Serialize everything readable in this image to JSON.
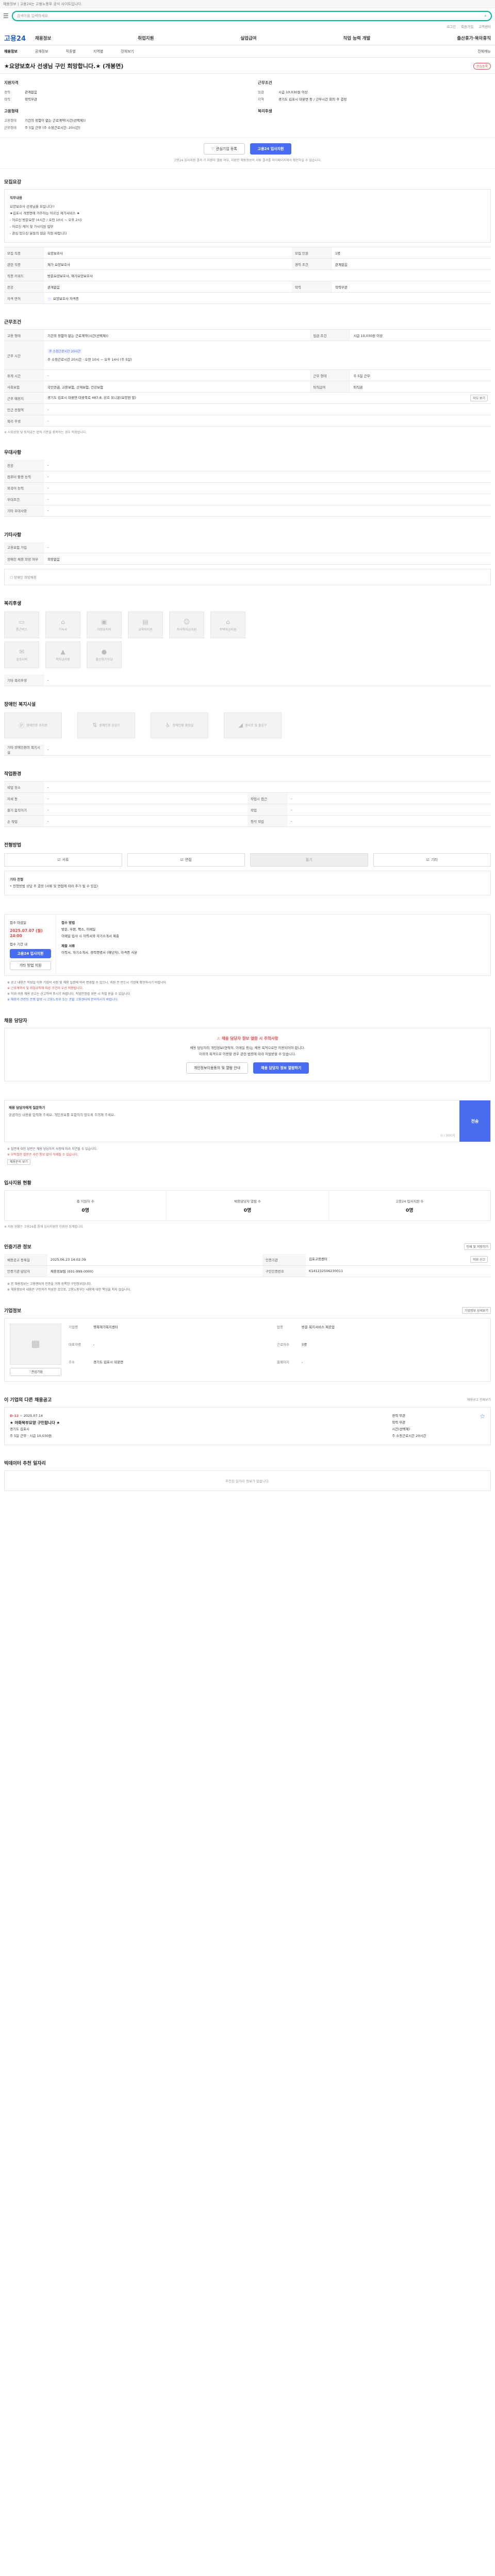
{
  "notice": "채용정보 | 고용24는 고용노동부 공식 사이트입니다.",
  "search": {
    "placeholder": "검색어를 입력하세요"
  },
  "util": [
    "로그인",
    "회원가입",
    "고객센터"
  ],
  "logo": "고용24",
  "gnb": [
    "채용정보",
    "취업지원",
    "실업급여",
    "직업 능력 개발",
    "출산휴가·육아휴직"
  ],
  "subnav": [
    "채용정보",
    "공채정보",
    "직종별",
    "지역별",
    "전체보기",
    "전체메뉴"
  ],
  "title": "★요양보호사 선생님 구인 희망합니다.★ (개봉면)",
  "scrap": "관심등록",
  "summary": {
    "left_title": "지원자격",
    "left": [
      [
        "경력",
        "관계없음"
      ],
      [
        "학력",
        "학력무관"
      ]
    ],
    "right_title": "근무조건",
    "right": [
      [
        "임금",
        "시급 10,030원 이상"
      ],
      [
        "지역",
        "경기도 김포시 대곶면 등 / 근무시간 회의 후 결정"
      ]
    ],
    "left2_title": "고용형태",
    "left2": [
      [
        "고용형태",
        "기간의 정함이 없는 근로계약(시간(선택제))"
      ],
      [
        "근무형태",
        "주 5일 근무 (주 소정근로시간: 20시간)"
      ]
    ],
    "right2_title": "복리후생",
    "right2": []
  },
  "apply": {
    "interest_btn": "관심기업 등록",
    "apply_btn": "고용24 입사지원",
    "note": "고용24 입사지원 결과 기 지원자 열람 여부, 지원한 채용정보의 서류 결과를 마이페이지에서 확인하실 수 있습니다."
  },
  "recruit": {
    "heading": "모집요강",
    "box_title": "직무내용",
    "box_lines": [
      "요양보호사 선생님을 모십니다!!",
      "★김포시 개봉면에 거주하는 어르신 재가서비스 ★",
      "- 어르신 방문요양 (4시간 / 오전 10시 ~ 오후 2시)",
      "- 어르신 케어 및 가사지원 업무",
      "- 관심 있으신 분들의 많은 지원 바랍니다"
    ],
    "rows": [
      [
        "모집 직종",
        "요양보호사",
        "모집 인원",
        "1명"
      ],
      [
        "관련 직종",
        "재가 요양보호사",
        "경력 조건",
        "관계없음"
      ],
      [
        "직종 키워드",
        "방문요양보호사, 재가요양보호사",
        "",
        ""
      ],
      [
        "전공",
        "관계없음",
        "학력",
        "학력무관"
      ],
      [
        "자격 면허",
        "요양보호사 자격증",
        "",
        ""
      ]
    ]
  },
  "conditions": {
    "heading": "근무조건",
    "rows": [
      [
        "고용 형태",
        "기간의 정함이 없는 근로계약(시간(선택제))",
        "임금 조건",
        "시급 10,030원 이상"
      ],
      [
        "근무 시간",
        "주 소정근로시간 20시간 · 오전 10시 ~ 오후 14시 (주 5일)",
        "",
        ""
      ],
      [
        "휴게 시간",
        "-",
        "근무 형태",
        "주 5일 근무"
      ],
      [
        "사회보험",
        "국민연금, 고용보험, 산재보험, 건강보험",
        "퇴직급여",
        "퇴직금"
      ],
      [
        "근무 예정지",
        "경기도 김포시 대곶면 대곶북로 487-8, 상호 유니온(요양원 앞)",
        "",
        ""
      ],
      [
        "인근 전철역",
        "-",
        "",
        ""
      ],
      [
        "복리 후생",
        "-",
        "",
        ""
      ]
    ],
    "map_btn": "지도 보기",
    "tag": "주 소정근로시간 20시간",
    "note": "※ 사회보험 및 퇴직금은 법적 기준을 충족하는 경우 적용됩니다."
  },
  "preferences": {
    "heading": "우대사항",
    "rows": [
      [
        "전공",
        "-"
      ],
      [
        "컴퓨터 활용 능력",
        "-"
      ],
      [
        "외국어 능력",
        "-"
      ],
      [
        "우대조건",
        "-"
      ],
      [
        "기타 우대사항",
        "-"
      ]
    ]
  },
  "other": {
    "heading": "기타사항",
    "rows": [
      [
        "고용보험 가입",
        "-"
      ],
      [
        "장애인 채용 희망 여부",
        "희망없음"
      ]
    ],
    "checkbox": "장애인 희망채용"
  },
  "welfare": {
    "heading": "복리후생",
    "items": [
      "통근버스",
      "기숙사",
      "차량유지비",
      "교육비지원",
      "자녀학자금지원",
      "주택자금지원",
      "경조사비",
      "학자금지원",
      "출산휴가수당"
    ],
    "other_label": "기타 복리후생",
    "other_value": "-"
  },
  "disability": {
    "heading": "장애인 복지시설",
    "items": [
      "장애인용 주차장",
      "장애인용 승강기",
      "장애인용 화장실",
      "경사로 및 출입구"
    ],
    "other_label": "기타 장애인편의 복지시설",
    "other_value": "-"
  },
  "environment": {
    "heading": "작업환경",
    "rows": [
      [
        "작업 장소",
        "-",
        "",
        ""
      ],
      [
        "자세 등",
        "-",
        "작업시 접근",
        "-"
      ],
      [
        "들기 움직이기",
        "-",
        "작업",
        "-"
      ],
      [
        "손 작업",
        "-",
        "청각 작업",
        "-"
      ]
    ]
  },
  "process": {
    "heading": "전형방법",
    "steps": [
      "서류",
      "면접",
      "필기",
      "기타"
    ],
    "box_lines": [
      "기타 전형",
      "• 전형방법 상담 후 결정 (서류 및 면접에 따라 추가 될 수 있음)"
    ]
  },
  "reception": {
    "period_label": "접수 마감일",
    "deadline": "2025.07.07 (월) 24:00",
    "sub": "접수 기간 내",
    "apply_btn": "고용24 입사지원",
    "other_btn": "기타 방법 지원",
    "method_title": "접수 방법",
    "method_lines": [
      "방문, 우편, 팩스, 이메일",
      "이메일 입사 시 이력서와 자기소개서 제출"
    ],
    "docs_title": "제출 서류",
    "docs": "이력서, 자기소개서, 경력증명서 (해당자), 자격증 사본"
  },
  "warnings": [
    "※ 공고 내용은 작성일 이후 기업의 사정 및 채용 일정에 따라 변경될 수 있으니, 지원 전 반드시 기업에 확인하시기 바랍니다.",
    "※ 근로계약서 및 취업규칙에 따른 조건이 우선 적용됩니다.",
    "※ 허위·과장 채용 공고는 신고하여 주시기 바랍니다. 직업안정법 위반 시 처벌 받을 수 있습니다.",
    "※ 채용과 관련된 분쟁 발생 시 고용노동부 또는 관할 고용센터에 문의하시기 바랍니다."
  ],
  "contact": {
    "heading": "채용 담당자",
    "safe_title": "채용 담당자 정보 열람 시 주의사항",
    "safe_lines": [
      "채용 담당자의 개인정보(연락처, 이메일 등)는 채용 목적으로만 이용되어야 합니다.",
      "이외의 목적으로 이용할 경우 관련 법령에 따라 처벌받을 수 있습니다."
    ],
    "btn1": "개인정보이용동의 및 열람 안내",
    "btn2": "채용 담당자 정보 열람하기"
  },
  "inquiry": {
    "label": "채용 담당자에게 질문하기",
    "placeholder": "궁금하신 내용을 입력해 주세요. 개인정보를 포함하지 않도록 주의해 주세요.",
    "counter": "0 / 500자",
    "button": "전송",
    "notes": [
      "※ 질문에 대한 답변은 채용 담당자의 사정에 따라 지연될 수 있습니다.",
      "※ 부적절한 질문은 사전 통보 없이 삭제될 수 있습니다."
    ],
    "view_btn": "채용문의 보기"
  },
  "stats": {
    "heading": "입사지원 현황",
    "items": [
      [
        "총 지원자 수",
        "0명"
      ],
      [
        "채용담당자 열람 수",
        "0명"
      ],
      [
        "고용24 입사지원 수",
        "0명"
      ]
    ],
    "note": "※ 지원 현황은 고용24를 통해 입사지원한 인원만 집계됩니다."
  },
  "info": {
    "heading": "인증기관 정보",
    "print_btn": "인쇄 및 저장하기",
    "rows": [
      [
        "채용공고 등록일",
        "2025.06.23 14:02:39",
        "인증기관",
        "김포고용센터"
      ],
      [
        "인증기관 담당자",
        "채용정보팀 (031-999-0000)",
        "구인인증번호",
        "K141232506230011"
      ]
    ],
    "report_btn": "허위 신고",
    "notes": [
      "※ 본 채용정보는 고용센터의 인증을 거쳐 등록된 구인정보입니다.",
      "※ 채용정보의 내용은 구인자가 작성한 것으로, 고용노동부는 내용에 대한 책임을 지지 않습니다."
    ]
  },
  "company": {
    "heading": "기업정보",
    "more_btn": "기업정보 상세보기",
    "rows": [
      [
        "기업명",
        "행복재가복지센터"
      ],
      [
        "업종",
        "방문 복지서비스 제공업"
      ],
      [
        "대표자명",
        "-"
      ],
      [
        "근로자수",
        "5명"
      ],
      [
        "주소",
        "경기도 김포시 대곶면"
      ],
      [
        "홈페이지",
        "-"
      ]
    ],
    "follow_btn": "관심기업"
  },
  "others": {
    "heading": "이 기업의 다른 채용공고",
    "more": "채용공고 전체보기",
    "card": {
      "dday": "D-12",
      "date": "~ 2025.07.14",
      "title": "★ 야화북부요양 구인합니다 ★",
      "lines": [
        "경기도 김포시",
        "주 5일 근무 · 시급 10,030원"
      ],
      "right": [
        "경력 무관",
        "학력 무관",
        "시간(선택제)",
        "주 소정근로시간 20시간"
      ]
    }
  },
  "recommend": {
    "heading": "빅데이터 추천 일자리",
    "empty": "추천된 일자리 정보가 없습니다."
  }
}
